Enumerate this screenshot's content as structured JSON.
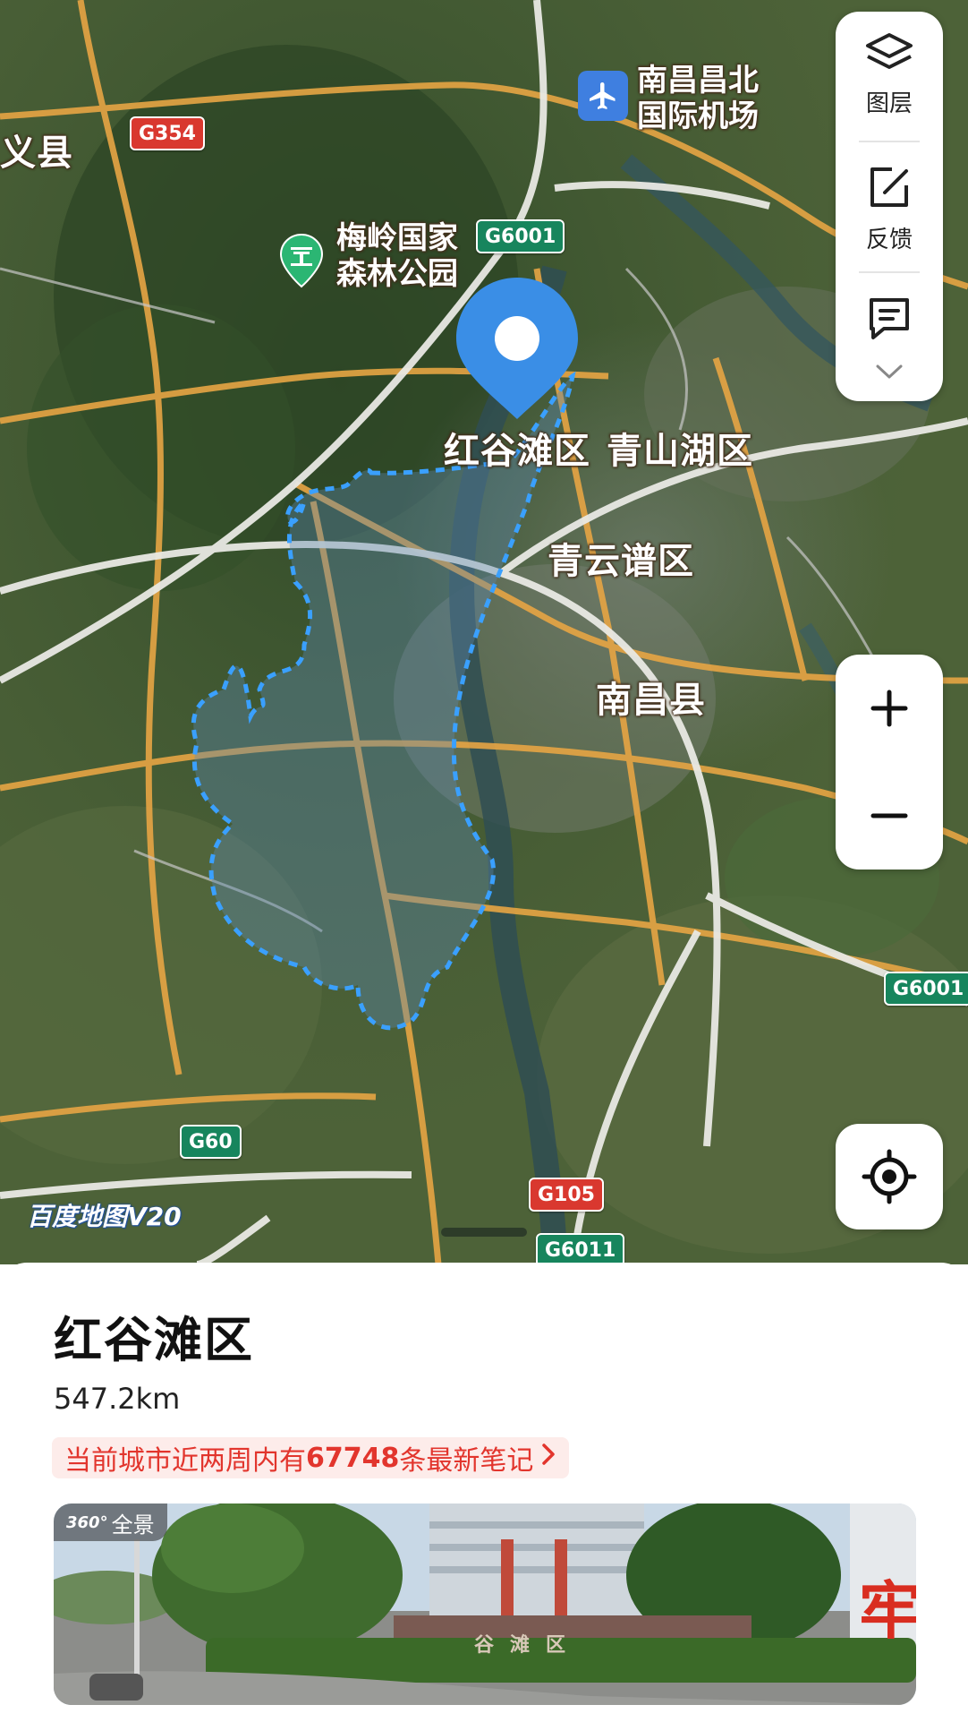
{
  "map": {
    "district_labels": {
      "honggutan": "红谷滩区",
      "qingshanhu": "青山湖区",
      "qingyunpu": "青云谱区",
      "nanchang_county": "南昌县",
      "partial_left": "义县"
    },
    "pois": {
      "airport": {
        "line1": "南昌昌北",
        "line2": "国际机场",
        "icon": "airplane-icon"
      },
      "forest_park": {
        "line1": "梅岭国家",
        "line2": "森林公园",
        "icon": "park-icon"
      }
    },
    "road_shields": {
      "g354": "G354",
      "g6001_top": "G6001",
      "g6001_right": "G6001",
      "g60": "G60",
      "g105": "G105",
      "g6011": "G6011"
    },
    "watermark": "百度地图V20",
    "colors": {
      "pin": "#3a8ee6",
      "boundary": "#3aa0ff",
      "road_orange": "#e7a544",
      "shield_green": "#17855d",
      "shield_red": "#d9382f"
    }
  },
  "toolbar": {
    "layers_label": "图层",
    "layers_icon": "layers-icon",
    "feedback_label": "反馈",
    "feedback_icon": "feedback-edit-icon",
    "message_icon": "message-icon",
    "expand_icon": "chevron-down-icon"
  },
  "zoom": {
    "in_icon": "plus-icon",
    "out_icon": "minus-icon"
  },
  "locate": {
    "icon": "locate-target-icon"
  },
  "info": {
    "title": "红谷滩区",
    "area": "547.2km",
    "notes_prefix": "当前城市近两周内有",
    "notes_count": "67748",
    "notes_suffix": "条最新笔记",
    "panorama_badge_deg": "360°",
    "panorama_badge_label": "全景",
    "panorama_sign_text": "谷滩区",
    "panorama_red_char": "牢"
  }
}
